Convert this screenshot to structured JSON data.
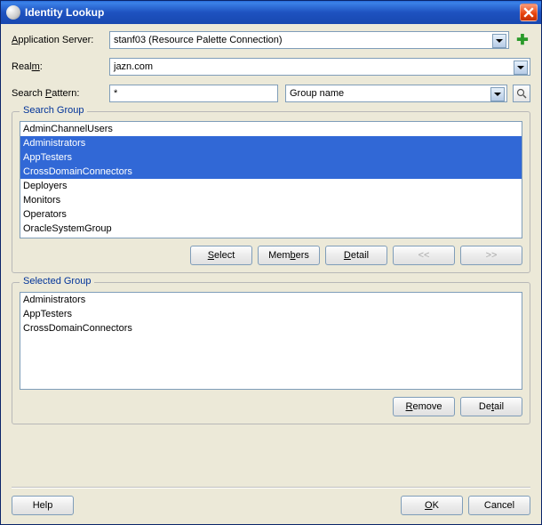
{
  "window": {
    "title": "Identity Lookup"
  },
  "fields": {
    "appServer": {
      "label_pre": "",
      "label_mid": "A",
      "label_post": "pplication Server:",
      "value": "stanf03 (Resource Palette Connection)"
    },
    "realm": {
      "label_pre": "Real",
      "label_mid": "m",
      "label_post": ":",
      "value": "jazn.com"
    },
    "pattern": {
      "label_pre": "Search ",
      "label_mid": "P",
      "label_post": "attern:",
      "value": "*"
    },
    "criteria": {
      "value": "Group name"
    }
  },
  "searchGroup": {
    "legend": "Search Group",
    "items": [
      {
        "text": "AdminChannelUsers",
        "selected": false
      },
      {
        "text": "Administrators",
        "selected": true
      },
      {
        "text": "AppTesters",
        "selected": true
      },
      {
        "text": "CrossDomainConnectors",
        "selected": true
      },
      {
        "text": "Deployers",
        "selected": false
      },
      {
        "text": "Monitors",
        "selected": false
      },
      {
        "text": "Operators",
        "selected": false
      },
      {
        "text": "OracleSystemGroup",
        "selected": false
      }
    ],
    "buttons": {
      "select": {
        "pre": "",
        "mid": "S",
        "post": "elect"
      },
      "members": {
        "pre": "Mem",
        "mid": "b",
        "post": "ers"
      },
      "detail": {
        "pre": "",
        "mid": "D",
        "post": "etail"
      },
      "prev": "<<",
      "next": ">>"
    }
  },
  "selectedGroup": {
    "legend": "Selected Group",
    "items": [
      {
        "text": "Administrators"
      },
      {
        "text": "AppTesters"
      },
      {
        "text": "CrossDomainConnectors"
      }
    ],
    "buttons": {
      "remove": {
        "pre": "",
        "mid": "R",
        "post": "emove"
      },
      "detail": {
        "pre": "De",
        "mid": "t",
        "post": "ail"
      }
    }
  },
  "footer": {
    "help": "Help",
    "ok": {
      "pre": "",
      "mid": "O",
      "post": "K"
    },
    "cancel": "Cancel"
  }
}
